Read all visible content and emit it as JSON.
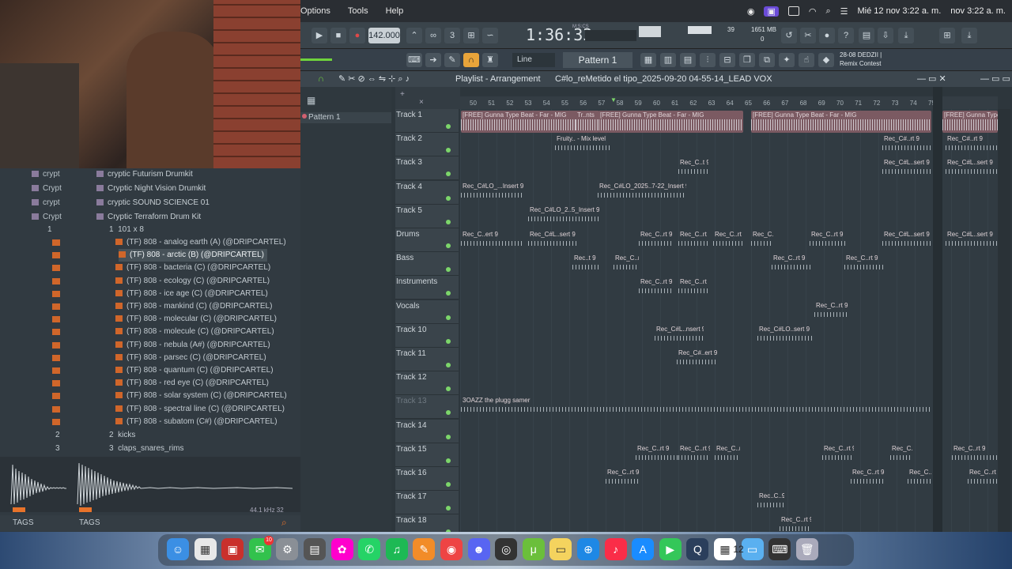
{
  "menubar": {
    "options": "Options",
    "tools": "Tools",
    "help": "Help",
    "clock1": "Mié 12 nov  3:22 a. m.",
    "clock2": "nov  3:22 a. m."
  },
  "transport": {
    "tempo": "142.000",
    "time": "1:36:33",
    "time_label": "M:S:CS",
    "cpu": "39",
    "memory": "1651 MB",
    "voices": "0",
    "mode": "Line",
    "pattern": "Pattern 1"
  },
  "news": {
    "date": "28-08",
    "headline": "DEDZII |",
    "sub": "Remix Contest"
  },
  "playlist": {
    "title": "Playlist - Arrangement",
    "breadcrumb": "C#lo_reMetido el tipo_2025-09-20 04-55-14_LEAD VOX",
    "pattern_item": "Pattern 1"
  },
  "ruler": [
    "50",
    "51",
    "52",
    "53",
    "54",
    "55",
    "56",
    "57",
    "58",
    "59",
    "60",
    "61",
    "62",
    "63",
    "64",
    "65",
    "66",
    "67",
    "68",
    "69",
    "70",
    "71",
    "72",
    "73",
    "74",
    "75"
  ],
  "tracks": [
    "Track 1",
    "Track 2",
    "Track 3",
    "Track 4",
    "Track 5",
    "Drums",
    "Bass",
    "Instruments",
    "Vocals",
    "Track 10",
    "Track 11",
    "Track 12",
    "Track 13",
    "Track 14",
    "Track 15",
    "Track 16",
    "Track 17",
    "Track 18"
  ],
  "clips": {
    "t1": "[FREE] Gunna Type Beat - Far - MIG",
    "t1b": "Tr..nts",
    "t1c": "[FREE] Gunna Type Beat - Far - MIG",
    "t1d": "[FREE] Gunna Type Beat - Far - MIG",
    "t2": "Fruity.. - Mix level",
    "t2b": "Rec_C#..rt 9",
    "t3": "Rec_C..t 9",
    "t3b": "Rec_C#L..sert 9",
    "t4": "Rec_C#LO_...Insert 9",
    "t4b": "Rec_C#LO_2025..7-22_Insert 9",
    "t5": "Rec_C#LO_2..5_Insert 9",
    "drums1": "Rec_C..ert 9",
    "drums2": "Rec_C#L..sert 9",
    "bass1": "Rec..t 9",
    "bass2": "Rec_C..rt 9",
    "vox1": "Rec_C..rt 9",
    "t10a": "Rec_C#L..nsert 9",
    "t10b": "Rec_C#LO..sert 9",
    "t11": "Rec_C#..ert 9",
    "t13": "3OAZZ the plugg samer",
    "t15": "Rec_C..rt 9",
    "t16": "Rec_C..rt 9",
    "t17": "Rec..C..9",
    "t18": "Rec_C..rt 9"
  },
  "browser": {
    "folders_top": [
      "cryptic Futurism Drumkit",
      "Cryptic Night Vision Drumkit",
      "cryptic SOUND SCIENCE 01",
      "Cryptic Terraform Drum Kit"
    ],
    "left_col": [
      "crypt",
      "Crypt",
      "crypt",
      "Crypt"
    ],
    "subfolder": "101 x 8",
    "subfolder_num": "1",
    "files": [
      "(TF) 808 - analog earth (A) (@DRIPCARTEL)",
      "(TF) 808 - arctic (B) (@DRIPCARTEL)",
      "(TF) 808 - bacteria (C) (@DRIPCARTEL)",
      "(TF) 808 - ecology (C) (@DRIPCARTEL)",
      "(TF) 808 - ice age (C) (@DRIPCARTEL)",
      "(TF) 808 - mankind (C) (@DRIPCARTEL)",
      "(TF) 808 - molecular (C) (@DRIPCARTEL)",
      "(TF) 808 - molecule (C) (@DRIPCARTEL)",
      "(TF) 808 - nebula (A#) (@DRIPCARTEL)",
      "(TF) 808 - parsec (C) (@DRIPCARTEL)",
      "(TF) 808 - quantum (C) (@DRIPCARTEL)",
      "(TF) 808 - red eye (C) (@DRIPCARTEL)",
      "(TF) 808 - solar system (C) (@DRIPCARTEL)",
      "(TF) 808 - spectral line (C) (@DRIPCARTEL)",
      "(TF) 808 - subatom (C#) (@DRIPCARTEL)"
    ],
    "kicks": "kicks",
    "kicks_num": "2",
    "claps": "claps_snares_rims",
    "claps_num": "3",
    "left_nums": [
      "1",
      "2",
      "3"
    ],
    "sample_info": "44.1 kHz 32",
    "tags": "TAGS"
  },
  "dock_badges": {
    "messages": "10",
    "calendar": "12"
  }
}
